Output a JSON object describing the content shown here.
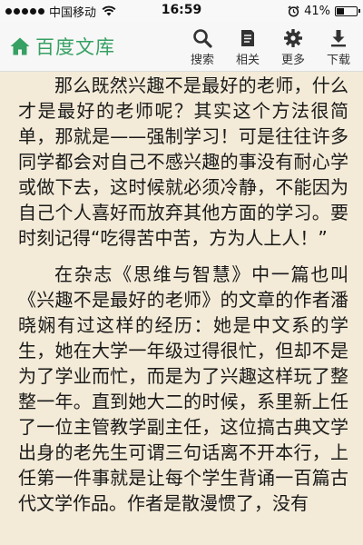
{
  "status_bar": {
    "carrier": "中国移动",
    "time": "16:59",
    "battery": "41%",
    "battery_level": 0.41,
    "icons": [
      "signal-dots-icon",
      "wifi-icon",
      "alarm-icon",
      "battery-icon"
    ]
  },
  "nav": {
    "brand": "百度文库",
    "brand_color": "#37a063",
    "actions": [
      {
        "label": "搜索",
        "icon": "search-icon"
      },
      {
        "label": "相关",
        "icon": "document-icon"
      },
      {
        "label": "更多",
        "icon": "gear-icon"
      },
      {
        "label": "下载",
        "icon": "download-icon"
      }
    ]
  },
  "content": {
    "paragraphs": [
      "那么既然兴趣不是最好的老师，什么才是最好的老师呢？其实这个方法很简单，那就是——强制学习！可是往往许多同学都会对自己不感兴趣的事没有耐心学或做下去，这时候就必须冷静，不能因为自己个人喜好而放弃其他方面的学习。要时刻记得“吃得苦中苦，方为人上人！”",
      "在杂志《思维与智慧》中一篇也叫《兴趣不是最好的老师》的文章的作者潘晓娴有过这样的经历：她是中文系的学生，她在大学一年级过得很忙，但却不是为了学业而忙，而是为了兴趣这样玩了整整一年。直到她大二的时候，系里新上任了一位主管教学副主任，这位搞古典文学出身的老先生可谓三句话离不开本行，上任第一件事就是让每个学生背诵一百篇古代文学作品。作者是散漫惯了，没有"
    ]
  }
}
